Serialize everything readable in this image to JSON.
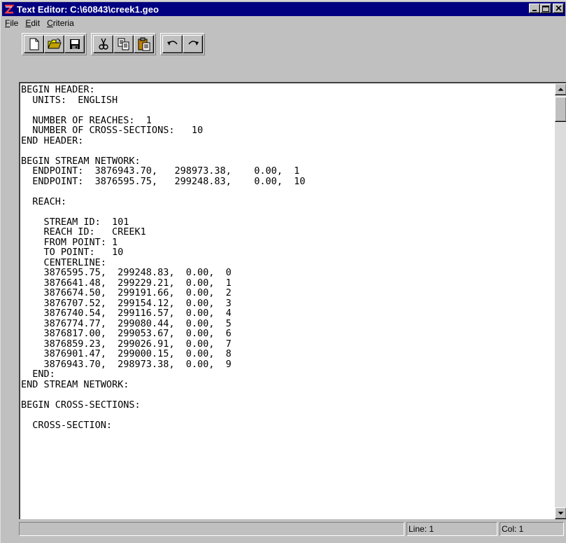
{
  "window": {
    "title": "Text Editor: C:\\60843\\creek1.geo",
    "min_label": "_",
    "max_label": "□",
    "close_label": "✕"
  },
  "menu": {
    "file": {
      "u": "F",
      "rest": "ile"
    },
    "edit": {
      "u": "E",
      "rest": "dit"
    },
    "criteria": {
      "u": "C",
      "rest": "riteria"
    }
  },
  "toolbar_icons": [
    "new-file-icon",
    "open-folder-icon",
    "save-icon",
    "cut-icon",
    "copy-icon",
    "paste-icon",
    "undo-icon",
    "redo-icon"
  ],
  "editor": {
    "content": "BEGIN HEADER:\n  UNITS:  ENGLISH\n\n  NUMBER OF REACHES:  1\n  NUMBER OF CROSS-SECTIONS:   10\nEND HEADER:\n\nBEGIN STREAM NETWORK:\n  ENDPOINT:  3876943.70,   298973.38,    0.00,  1\n  ENDPOINT:  3876595.75,   299248.83,    0.00,  10\n\n  REACH:\n\n    STREAM ID:  101\n    REACH ID:   CREEK1\n    FROM POINT: 1\n    TO POINT:   10\n    CENTERLINE:\n    3876595.75,  299248.83,  0.00,  0\n    3876641.48,  299229.21,  0.00,  1\n    3876674.50,  299191.66,  0.00,  2\n    3876707.52,  299154.12,  0.00,  3\n    3876740.54,  299116.57,  0.00,  4\n    3876774.77,  299080.44,  0.00,  5\n    3876817.00,  299053.67,  0.00,  6\n    3876859.23,  299026.91,  0.00,  7\n    3876901.47,  299000.15,  0.00,  8\n    3876943.70,  298973.38,  0.00,  9\n  END:\nEND STREAM NETWORK:\n\nBEGIN CROSS-SECTIONS:\n\n  CROSS-SECTION:"
  },
  "status": {
    "message": "",
    "line": "Line: 1",
    "col": "Col: 1"
  },
  "colors": {
    "titlebar": "#000080",
    "face": "#c0c0c0",
    "editor_bg": "#ffffff"
  }
}
